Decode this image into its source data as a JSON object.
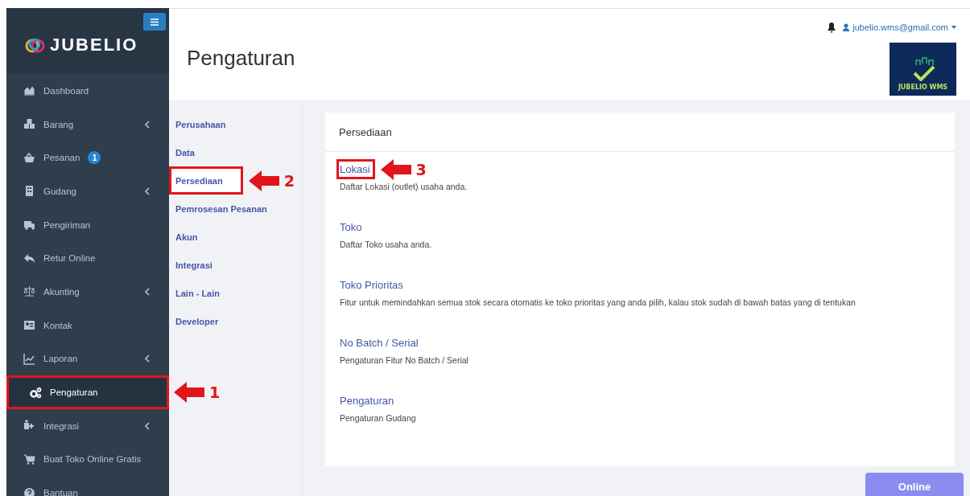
{
  "sidebar": {
    "logo_text": "JUBELIO",
    "items": [
      {
        "label": "Dashboard",
        "selected": false,
        "expandable": false
      },
      {
        "label": "Barang",
        "selected": false,
        "expandable": true
      },
      {
        "label": "Pesanan",
        "selected": false,
        "expandable": false,
        "badge": "1"
      },
      {
        "label": "Gudang",
        "selected": false,
        "expandable": true
      },
      {
        "label": "Pengiriman",
        "selected": false,
        "expandable": false
      },
      {
        "label": "Retur Online",
        "selected": false,
        "expandable": false
      },
      {
        "label": "Akunting",
        "selected": false,
        "expandable": true
      },
      {
        "label": "Kontak",
        "selected": false,
        "expandable": false
      },
      {
        "label": "Laporan",
        "selected": false,
        "expandable": true
      },
      {
        "label": "Pengaturan",
        "selected": true,
        "expandable": false,
        "callout": "1"
      },
      {
        "label": "Integrasi",
        "selected": false,
        "expandable": true
      },
      {
        "label": "Buat Toko Online Gratis",
        "selected": false,
        "expandable": false
      },
      {
        "label": "Bantuan",
        "selected": false,
        "expandable": false
      }
    ]
  },
  "topbar": {
    "page_title": "Pengaturan",
    "user_email": "jubelio.wms@gmail.com",
    "brand_logo_text": "JUBELIO WMS"
  },
  "settings_menu": [
    {
      "label": "Perusahaan",
      "selected": false
    },
    {
      "label": "Data",
      "selected": false
    },
    {
      "label": "Persediaan",
      "selected": true,
      "callout": "2"
    },
    {
      "label": "Pemrosesan Pesanan",
      "selected": false
    },
    {
      "label": "Akun",
      "selected": false
    },
    {
      "label": "Integrasi",
      "selected": false
    },
    {
      "label": "Lain - Lain",
      "selected": false
    },
    {
      "label": "Developer",
      "selected": false
    }
  ],
  "panel": {
    "title": "Persediaan",
    "sections": [
      {
        "title": "Lokasi",
        "description": "Daftar Lokasi (outlet) usaha anda.",
        "callout": "3"
      },
      {
        "title": "Toko",
        "description": "Daftar Toko usaha anda."
      },
      {
        "title": "Toko Prioritas",
        "description": "Fitur untuk memindahkan semua stok secara otomatis ke toko prioritas yang anda pilih, kalau stok sudah di bawah batas yang di tentukan"
      },
      {
        "title": "No Batch / Serial",
        "description": "Pengaturan Fitur No Batch / Serial"
      },
      {
        "title": "Pengaturan",
        "description": "Pengaturan Gudang"
      }
    ]
  },
  "online_button": "Online"
}
